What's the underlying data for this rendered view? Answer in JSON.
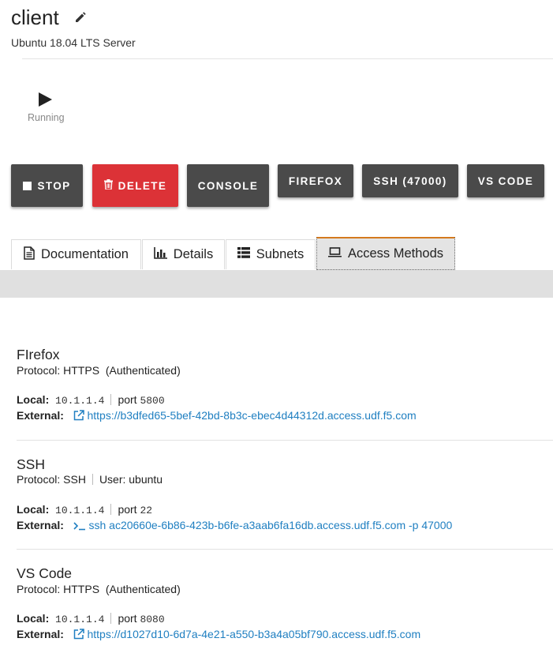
{
  "header": {
    "title": "client",
    "subtitle": "Ubuntu 18.04 LTS Server"
  },
  "status": {
    "label": "Running",
    "icon": "play-icon"
  },
  "actions": {
    "stop": "STOP",
    "delete": "DELETE",
    "console": "CONSOLE",
    "firefox": "FIREFOX",
    "ssh": "SSH (47000)",
    "vscode": "VS CODE"
  },
  "tabs": [
    {
      "label": "Documentation",
      "icon": "document-icon"
    },
    {
      "label": "Details",
      "icon": "bar-chart-icon"
    },
    {
      "label": "Subnets",
      "icon": "list-icon"
    },
    {
      "label": "Access Methods",
      "icon": "laptop-icon",
      "active": true
    }
  ],
  "access_methods": [
    {
      "title": "FIrefox",
      "protocol": "Protocol: HTTPS",
      "extra": "(Authenticated)",
      "local_label": "Local:",
      "local_ip": "10.1.1.4",
      "port_label": "port",
      "port": "5800",
      "external_label": "External:",
      "external": "https://b3dfed65-5bef-42bd-8b3c-ebec4d44312d.access.udf.f5.com",
      "external_icon": "external-link-icon"
    },
    {
      "title": "SSH",
      "protocol": "Protocol: SSH",
      "extra": "User: ubuntu",
      "local_label": "Local:",
      "local_ip": "10.1.1.4",
      "port_label": "port",
      "port": "22",
      "external_label": "External:",
      "external": "ssh ac20660e-6b86-423b-b6fe-a3aab6fa16db.access.udf.f5.com -p 47000",
      "external_icon": "terminal-icon"
    },
    {
      "title": "VS Code",
      "protocol": "Protocol: HTTPS",
      "extra": "(Authenticated)",
      "local_label": "Local:",
      "local_ip": "10.1.1.4",
      "port_label": "port",
      "port": "8080",
      "external_label": "External:",
      "external": "https://d1027d10-6d7a-4e21-a550-b3a4a05bf790.access.udf.f5.com",
      "external_icon": "external-link-icon"
    }
  ],
  "colors": {
    "button_dark": "#4a4a4a",
    "button_danger": "#dc3237",
    "link": "#1f7fc1",
    "active_tab_accent": "#d47a1e"
  }
}
